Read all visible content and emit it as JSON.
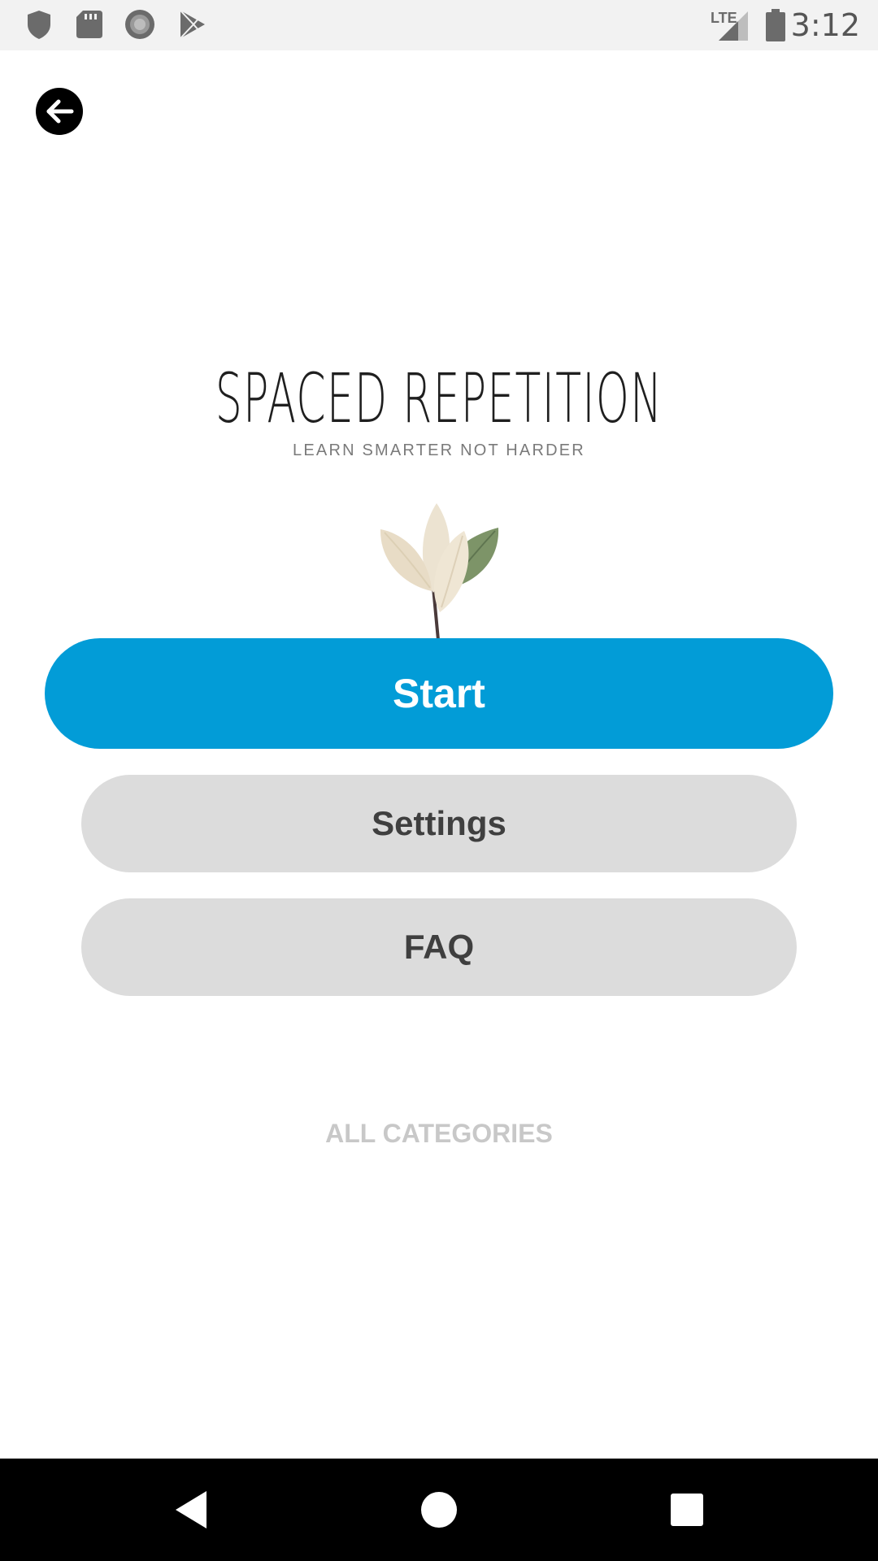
{
  "status_bar": {
    "time": "3:12",
    "network": "LTE",
    "icons": [
      "shield-icon",
      "sd-card-icon",
      "record-icon",
      "play-store-icon",
      "signal-icon",
      "battery-icon"
    ]
  },
  "header": {
    "back_icon": "arrow-left-icon"
  },
  "app": {
    "title": "SPACED REPETITION",
    "subtitle": "LEARN SMARTER NOT HARDER"
  },
  "menu": {
    "start_label": "Start",
    "settings_label": "Settings",
    "faq_label": "FAQ",
    "all_categories_label": "ALL CATEGORIES"
  },
  "nav_bar": {
    "icons": [
      "back-triangle-icon",
      "home-circle-icon",
      "recents-square-icon"
    ]
  },
  "colors": {
    "accent": "#029cd7",
    "secondary_button": "#dcdcdc",
    "status_bar_bg": "#f2f2f2",
    "nav_bar_bg": "#000000"
  }
}
